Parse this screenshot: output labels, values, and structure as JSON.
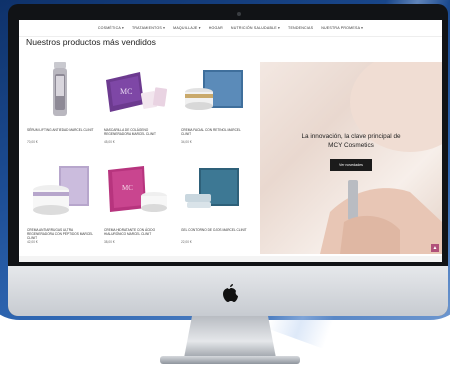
{
  "nav": {
    "items": [
      "Cosmética ▾",
      "Tratamientos ▾",
      "Maquillaje ▾",
      "Hogar",
      "Nutrición saludable ▾",
      "Tendencias",
      "Nuestra promesa ▾"
    ]
  },
  "section": {
    "title": "Nuestros productos más vendidos"
  },
  "products": [
    {
      "name": "Sérum Lifting Antiedad Marcel Clinit",
      "price": "70,00 €"
    },
    {
      "name": "Mascarilla de Colágeno Regeneradora Marcel Clinit",
      "price": "45,00 €"
    },
    {
      "name": "Crema Facial con Retinol Marcel Clinit",
      "price": "34,00 €"
    },
    {
      "name": "Crema Antiarrugas Ultra Regeneradora con Péptidos Marcel Clinit",
      "price": "42,00 €"
    },
    {
      "name": "Crema Hidratante con Ácido Hialurónico Marcel Clinit",
      "price": "38,00 €"
    },
    {
      "name": "Gel Contorno de Ojos Marcel Clinit",
      "price": "22,00 €"
    }
  ],
  "hero": {
    "line1": "La innovación, la clave principal de",
    "line2": "MCY Cosmetics",
    "button": "Ver novedades"
  },
  "scroll_top": "▲",
  "colors": {
    "accent": "#b0507a",
    "brand_blue": "#1c4c93"
  }
}
